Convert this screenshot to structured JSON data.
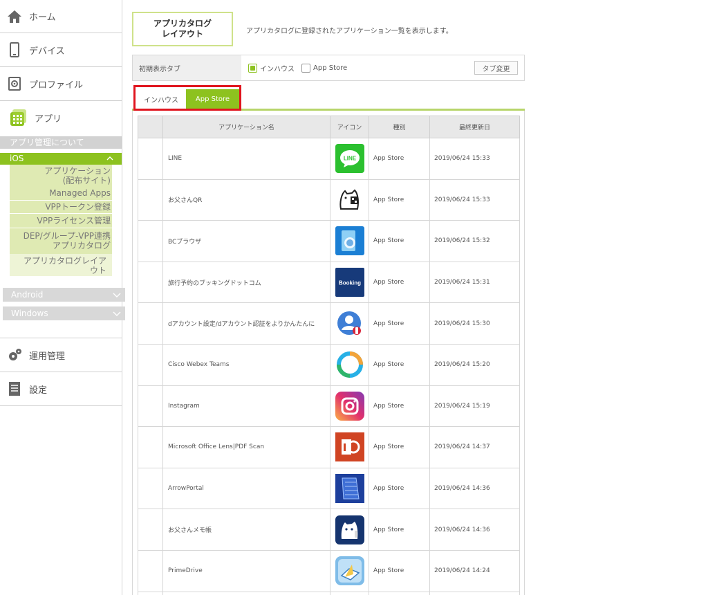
{
  "sidebar": {
    "home": "ホーム",
    "devices": "デバイス",
    "profiles": "プロファイル",
    "apps": "アプリ",
    "about_apps": "アプリ管理について",
    "ios": {
      "label": "iOS",
      "items": [
        "アプリケーション\n(配布サイト)",
        "Managed Apps",
        "VPPトークン登録",
        "VPPライセンス管理",
        "DEP/グループ-VPP連携\nアプリカタログ",
        "アプリカタログレイア\nウト"
      ]
    },
    "android": "Android",
    "windows": "Windows",
    "operations": "運用管理",
    "settings": "設定"
  },
  "header": {
    "title": "アプリカタログ\nレイアウト",
    "description": "アプリカタログに登録されたアプリケーション一覧を表示します。"
  },
  "default_tab_setting": {
    "label": "初期表示タブ",
    "options": [
      "インハウス",
      "App Store"
    ],
    "selected": "インハウス",
    "change_button": "タブ変更"
  },
  "tabs": [
    "インハウス",
    "App Store"
  ],
  "active_tab": "App Store",
  "table": {
    "headers": [
      "",
      "アプリケーション名",
      "アイコン",
      "種別",
      "最終更新日"
    ],
    "rows": [
      {
        "name": "LINE",
        "icon": "line-icon",
        "type": "App Store",
        "date": "2019/06/24 15:33"
      },
      {
        "name": "お父さんQR",
        "icon": "otosan-qr-icon",
        "type": "App Store",
        "date": "2019/06/24 15:33"
      },
      {
        "name": "BCブラウザ",
        "icon": "bc-browser-icon",
        "type": "App Store",
        "date": "2019/06/24 15:32"
      },
      {
        "name": "旅行予約のブッキングドットコム",
        "icon": "booking-icon",
        "type": "App Store",
        "date": "2019/06/24 15:31"
      },
      {
        "name": "dアカウント設定/dアカウント認証をよりかんたんに",
        "icon": "d-account-icon",
        "type": "App Store",
        "date": "2019/06/24 15:30"
      },
      {
        "name": "Cisco Webex Teams",
        "icon": "webex-icon",
        "type": "App Store",
        "date": "2019/06/24 15:20"
      },
      {
        "name": "Instagram",
        "icon": "instagram-icon",
        "type": "App Store",
        "date": "2019/06/24 15:19"
      },
      {
        "name": "Microsoft Office Lens|PDF Scan",
        "icon": "office-lens-icon",
        "type": "App Store",
        "date": "2019/06/24 14:37"
      },
      {
        "name": "ArrowPortal",
        "icon": "arrowportal-icon",
        "type": "App Store",
        "date": "2019/06/24 14:36"
      },
      {
        "name": "お父さんメモ帳",
        "icon": "otosan-memo-icon",
        "type": "App Store",
        "date": "2019/06/24 14:36"
      },
      {
        "name": "PrimeDrive",
        "icon": "primedrive-icon",
        "type": "App Store",
        "date": "2019/06/24 14:24"
      },
      {
        "name": "",
        "icon": "",
        "type": "",
        "date": ""
      }
    ]
  },
  "icon_texts": {
    "line": "LINE",
    "booking": "Booking"
  },
  "colors": {
    "accent": "#8dc21f",
    "highlight": "#e0141e"
  }
}
